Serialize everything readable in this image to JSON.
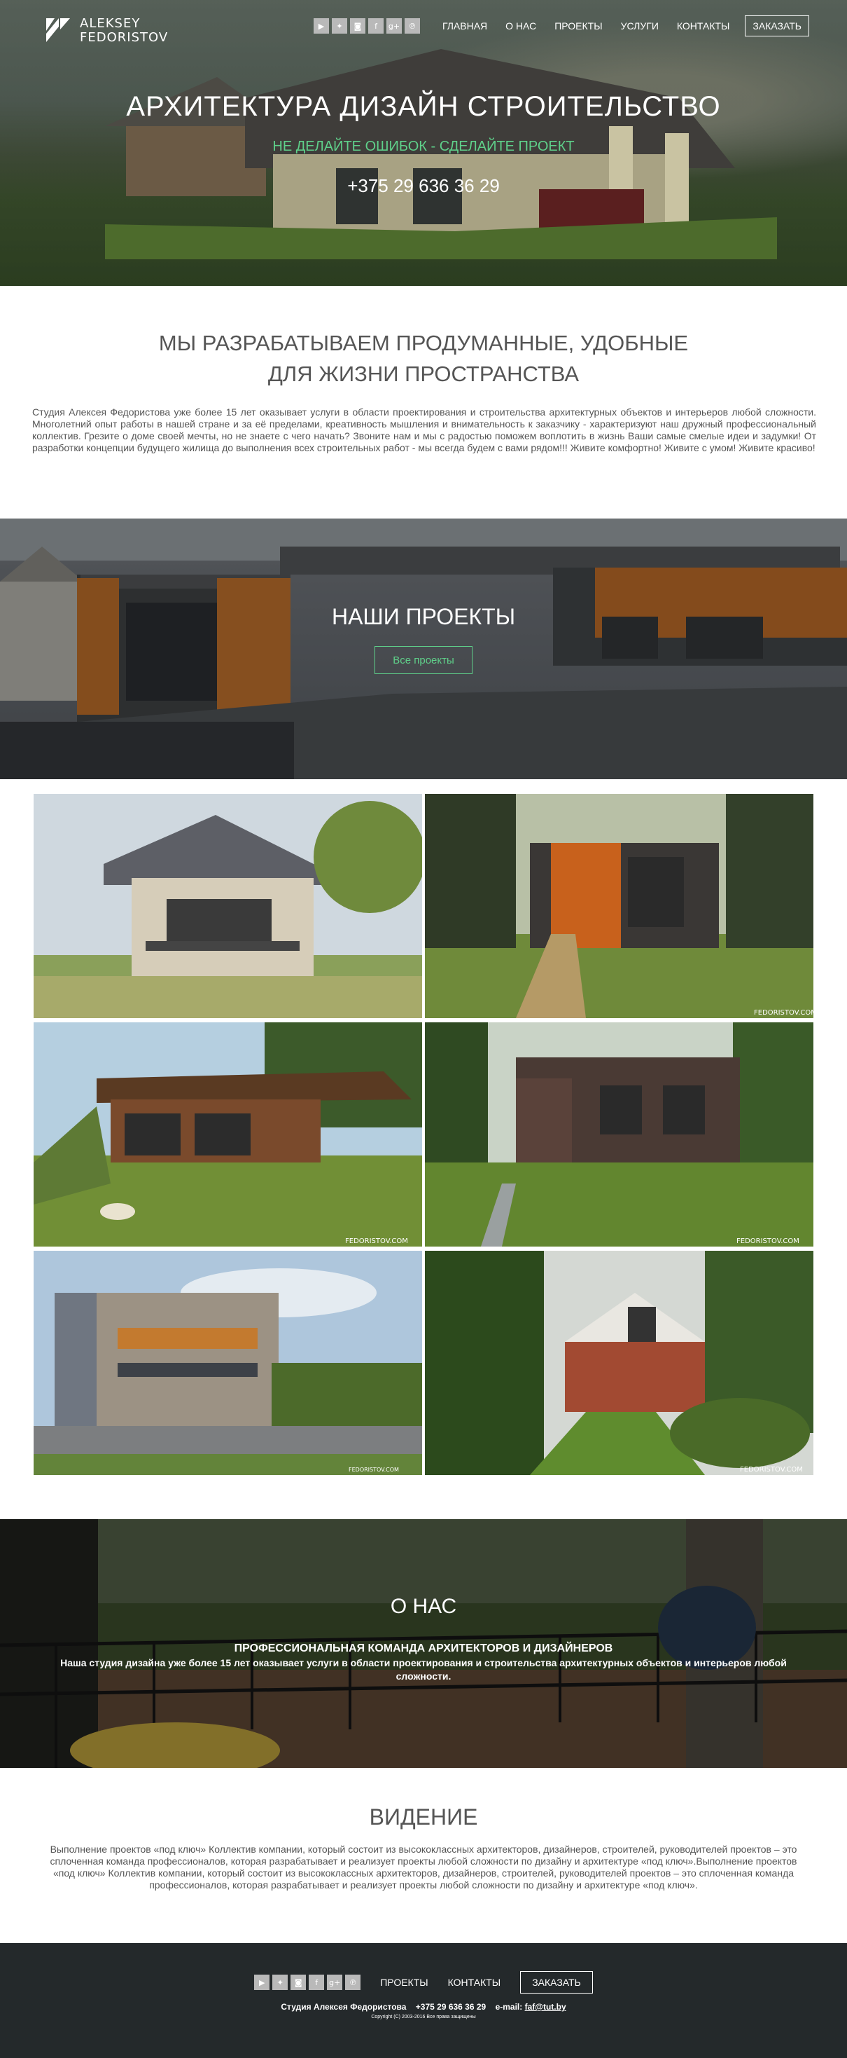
{
  "brand": {
    "line1": "ALEKSEY",
    "line2": "FEDORISTOV"
  },
  "social": [
    {
      "icon": "youtube-icon",
      "glyph": "▶"
    },
    {
      "icon": "twitter-icon",
      "glyph": "✦"
    },
    {
      "icon": "instagram-icon",
      "glyph": "◙"
    },
    {
      "icon": "facebook-icon",
      "glyph": "f"
    },
    {
      "icon": "google-plus-icon",
      "glyph": "g+"
    },
    {
      "icon": "pinterest-icon",
      "glyph": "℗"
    }
  ],
  "nav": {
    "home": "ГЛАВНАЯ",
    "about": "О НАС",
    "projects": "ПРОЕКТЫ",
    "services": "УСЛУГИ",
    "contacts": "КОНТАКТЫ",
    "order": "ЗАКАЗАТЬ"
  },
  "hero": {
    "title": "АРХИТЕКТУРА  ДИЗАЙН  СТРОИТЕЛЬСТВО",
    "slogan": "НЕ ДЕЛАЙТЕ ОШИБОК - СДЕЛАЙТЕ ПРОЕКТ",
    "phone": "+375 29 636 36 29"
  },
  "intro": {
    "title_line1": "МЫ РАЗРАБАТЫВАЕМ ПРОДУМАННЫЕ, УДОБНЫЕ",
    "title_line2": "ДЛЯ ЖИЗНИ ПРОСТРАНСТВА",
    "text": "Студия Алексея Федористова уже более 15 лет оказывает услуги в области проектирования и строительства архитектурных объектов и интерьеров любой сложности. Многолетний опыт работы в нашей стране и за её пределами, креативность мышления и внимательность к заказчику - характеризуют наш дружный профессиональный коллектив. Грезите о доме своей мечты, но не знаете с чего начать? Звоните нам и мы с радостью поможем воплотить в жизнь Ваши самые смелые идеи и задумки! От разработки концепции будущего жилища до выполнения всех строительных работ - мы всегда будем с вами рядом!!! Живите комфортно! Живите с умом! Живите красиво!"
  },
  "projects": {
    "title": "НАШИ ПРОЕКТЫ",
    "button": "Все проекты"
  },
  "gallery": [
    {
      "name": "project-photo-brick-house",
      "watermark": ""
    },
    {
      "name": "project-photo-orange-cottage",
      "watermark": "FEDORISTOV.COM"
    },
    {
      "name": "project-photo-timber-house",
      "watermark": "FEDORISTOV.COM"
    },
    {
      "name": "project-photo-modern-house",
      "watermark": "FEDORISTOV.COM"
    },
    {
      "name": "project-photo-office-building",
      "watermark": "FEDORISTOV.COM"
    },
    {
      "name": "project-photo-garden-house",
      "watermark": "FEDORISTOV.COM"
    }
  ],
  "about": {
    "title": "О НАС",
    "subtitle": "ПРОФЕССИОНАЛЬНАЯ КОМАНДА АРХИТЕКТОРОВ И ДИЗАЙНЕРОВ",
    "text": "Наша студия дизайна уже более 15 лет оказывает услуги в области проектирования и строительства архитектурных объектов и интерьеров любой сложности."
  },
  "vision": {
    "title": "ВИДЕНИЕ",
    "text": "Выполнение проектов «под ключ» Коллектив компании, который состоит из высококлассных архитекторов, дизайнеров, строителей, руководителей проектов – это сплоченная команда профессионалов, которая разрабатывает и реализует проекты любой сложности по дизайну и архитектуре «под ключ».Выполнение проектов «под ключ» Коллектив компании, который состоит из высококлассных архитекторов, дизайнеров, строителей, руководителей проектов – это сплоченная команда профессионалов, которая разрабатывает и реализует проекты любой сложности по дизайну и архитектуре «под ключ»."
  },
  "footer": {
    "projects": "ПРОЕКТЫ",
    "contacts": "КОНТАКТЫ",
    "order": "ЗАКАЗАТЬ",
    "studio": "Студия Алексея Федористова",
    "phone": "+375 29 636 36 29",
    "email_label": "e-mail:",
    "email": "faf@tut.by",
    "copyright": "Copyright (C) 2003-2016 Все права защищены"
  },
  "colors": {
    "accent_green": "#5fd08a",
    "footer_bg": "#24292b",
    "text_gray": "#555555"
  }
}
